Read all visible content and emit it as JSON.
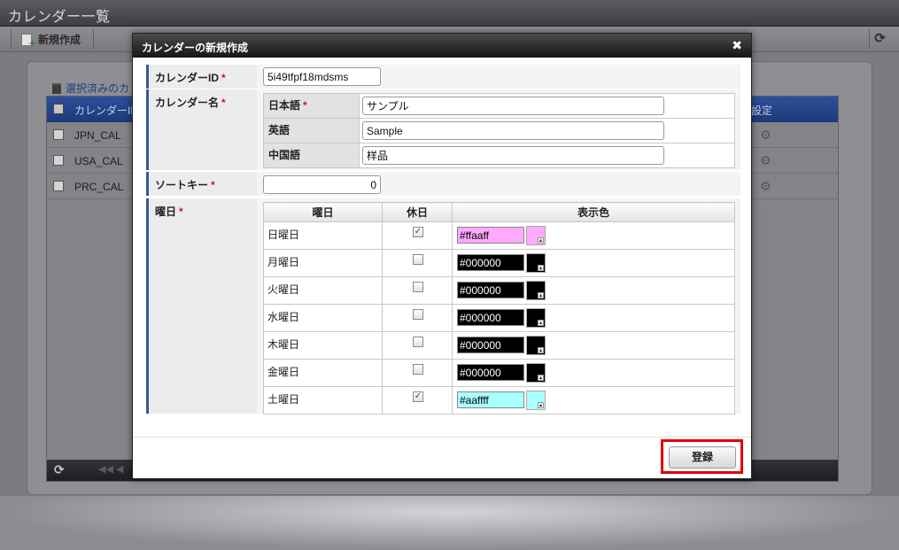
{
  "app": {
    "title": "カレンダー一覧",
    "toolbar": {
      "new_label": "新規作成",
      "refresh_glyph": "⟳"
    },
    "bulk_delete_label": "選択済みのカ",
    "grid": {
      "col_name": "カレンダーID",
      "col_settings": "設定",
      "rows": [
        {
          "name": "JPN_CAL"
        },
        {
          "name": "USA_CAL"
        },
        {
          "name": "PRC_CAL"
        }
      ],
      "footer_nav": "◀◀ ◀"
    }
  },
  "modal": {
    "title": "カレンダーの新規作成",
    "close_glyph": "✖",
    "calendar_id": {
      "label": "カレンダーID",
      "required": "*",
      "value": "5i49tfpf18mdsms"
    },
    "calendar_name": {
      "label": "カレンダー名",
      "required": "*",
      "rows": [
        {
          "label": "日本語",
          "required": "*",
          "value": "サンプル"
        },
        {
          "label": "英語",
          "required": "",
          "value": "Sample"
        },
        {
          "label": "中国語",
          "required": "",
          "value": "样品"
        }
      ]
    },
    "sort_key": {
      "label": "ソートキー",
      "required": "*",
      "value": "0"
    },
    "weekday": {
      "label": "曜日",
      "required": "*",
      "headers": {
        "day": "曜日",
        "holiday": "休日",
        "color": "表示色"
      },
      "rows": [
        {
          "day": "日曜日",
          "holiday": true,
          "color": "#ffaaff",
          "bg": "#ffaaff",
          "fg": "#000000"
        },
        {
          "day": "月曜日",
          "holiday": false,
          "color": "#000000",
          "bg": "#000000",
          "fg": "#ffffff"
        },
        {
          "day": "火曜日",
          "holiday": false,
          "color": "#000000",
          "bg": "#000000",
          "fg": "#ffffff"
        },
        {
          "day": "水曜日",
          "holiday": false,
          "color": "#000000",
          "bg": "#000000",
          "fg": "#ffffff"
        },
        {
          "day": "木曜日",
          "holiday": false,
          "color": "#000000",
          "bg": "#000000",
          "fg": "#ffffff"
        },
        {
          "day": "金曜日",
          "holiday": false,
          "color": "#000000",
          "bg": "#000000",
          "fg": "#ffffff"
        },
        {
          "day": "土曜日",
          "holiday": true,
          "color": "#aaffff",
          "bg": "#aaffff",
          "fg": "#000000"
        }
      ]
    },
    "register_label": "登録",
    "check_glyph": "✓",
    "swatch_arrow_glyph": "▴"
  }
}
